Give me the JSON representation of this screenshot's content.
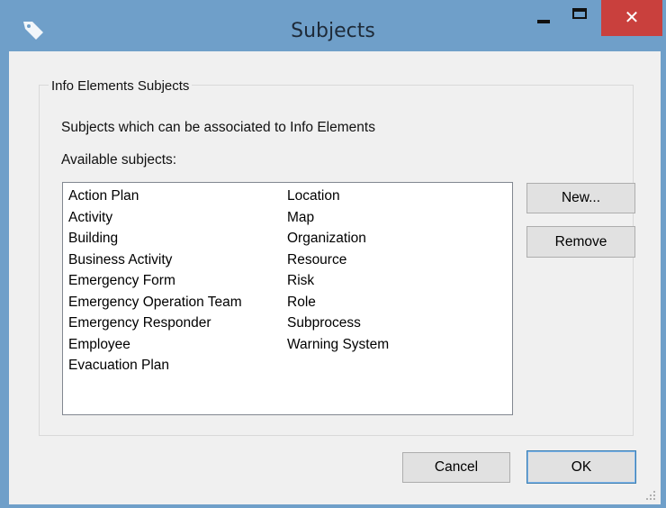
{
  "window": {
    "title": "Subjects",
    "icons": {
      "app": "tag-icon",
      "minimize": "minimize-icon",
      "maximize": "maximize-icon",
      "close": "close-icon"
    },
    "close_glyph": "✕"
  },
  "group": {
    "legend": "Info Elements Subjects",
    "description": "Subjects which can be associated to Info Elements",
    "available_label": "Available subjects:"
  },
  "subjects": {
    "column1": [
      "Action Plan",
      "Activity",
      "Building",
      "Business Activity",
      "Emergency Form",
      "Emergency Operation Team",
      "Emergency Responder",
      "Employee",
      "Evacuation Plan"
    ],
    "column2": [
      "Location",
      "Map",
      "Organization",
      "Resource",
      "Risk",
      "Role",
      "Subprocess",
      "Warning System"
    ]
  },
  "buttons": {
    "new": "New...",
    "remove": "Remove",
    "cancel": "Cancel",
    "ok": "OK"
  },
  "colors": {
    "titlebar": "#6f9fc9",
    "close_button": "#c9403d",
    "client": "#f0f0f0"
  }
}
